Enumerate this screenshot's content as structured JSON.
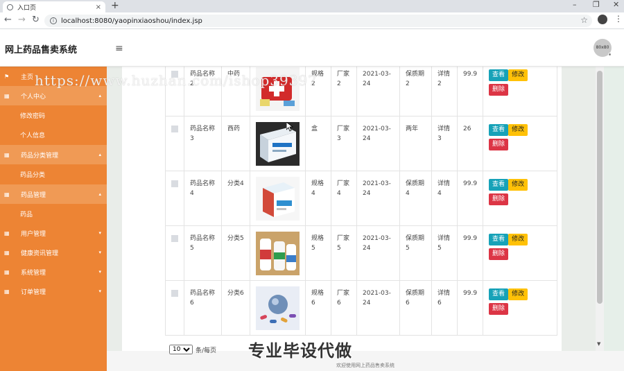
{
  "browser": {
    "tab_title": "入口页",
    "tab_close": "×",
    "new_tab": "+",
    "url": "localhost:8080/yaopinxiaoshou/index.jsp",
    "minimize": "–",
    "restore": "❐",
    "close": "✕"
  },
  "header": {
    "brand": "网上药品售卖系统",
    "menu_icon": "≡",
    "avatar_text": "80x80"
  },
  "sidebar": {
    "items": [
      {
        "label": "主页",
        "icon": "flag-icon"
      },
      {
        "label": "个人中心",
        "icon": "grid-icon"
      },
      {
        "label": "修改密码"
      },
      {
        "label": "个人信息"
      },
      {
        "label": "药品分类管理",
        "icon": "grid-icon"
      },
      {
        "label": "药品分类"
      },
      {
        "label": "药品管理",
        "icon": "grid-icon"
      },
      {
        "label": "药品"
      },
      {
        "label": "用户管理",
        "icon": "grid-icon"
      },
      {
        "label": "健康资讯管理",
        "icon": "grid-icon"
      },
      {
        "label": "系统管理",
        "icon": "grid-icon"
      },
      {
        "label": "订单管理",
        "icon": "grid-icon"
      }
    ]
  },
  "table": {
    "rows": [
      {
        "name": "药品名称2",
        "category": "中药",
        "spec": "规格2",
        "maker": "厂家2",
        "date": "2021-03-24",
        "shelf": "保质期2",
        "detail": "详情2",
        "price": "99.9"
      },
      {
        "name": "药品名称3",
        "category": "西药",
        "spec": "盒",
        "maker": "厂家3",
        "date": "2021-03-24",
        "shelf": "两年",
        "detail": "详情3",
        "price": "26"
      },
      {
        "name": "药品名称4",
        "category": "分类4",
        "spec": "规格4",
        "maker": "厂家4",
        "date": "2021-03-24",
        "shelf": "保质期4",
        "detail": "详情4",
        "price": "99.9"
      },
      {
        "name": "药品名称5",
        "category": "分类5",
        "spec": "规格5",
        "maker": "厂家5",
        "date": "2021-03-24",
        "shelf": "保质期5",
        "detail": "详情5",
        "price": "99.9"
      },
      {
        "name": "药品名称6",
        "category": "分类6",
        "spec": "规格6",
        "maker": "厂家6",
        "date": "2021-03-24",
        "shelf": "保质期6",
        "detail": "详情6",
        "price": "99.9"
      }
    ],
    "actions": {
      "view": "查看",
      "edit": "修改",
      "delete": "删除"
    }
  },
  "pager": {
    "page_size": "10",
    "suffix": "条/每页"
  },
  "footer": {
    "text": "欢迎使用网上药品售卖系统"
  },
  "overlay": {
    "watermark_url": "https://www.huzhan.com/ishop39397",
    "watermark_cn": "专业毕设代做"
  },
  "colors": {
    "sidebar": "#ed8434",
    "view": "#17a2b8",
    "edit": "#ffc107",
    "delete": "#dc3545"
  }
}
